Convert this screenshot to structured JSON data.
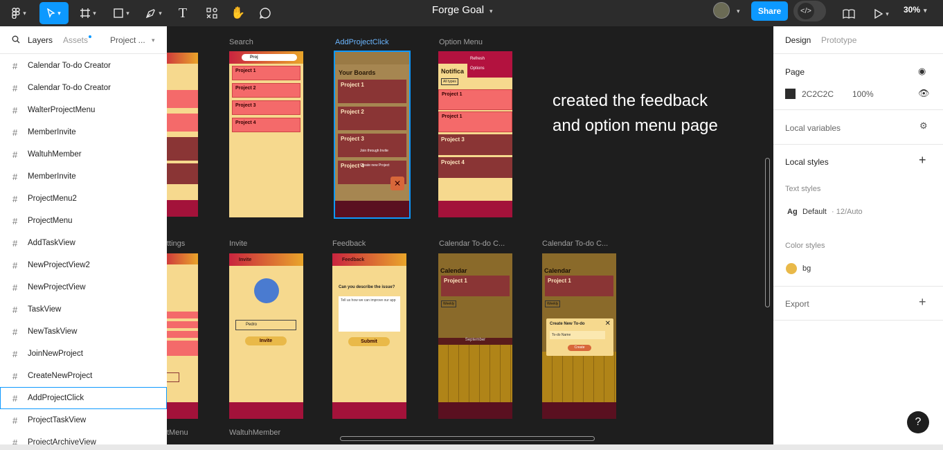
{
  "file": {
    "title": "Forge Goal"
  },
  "toolbar": {
    "share_label": "Share",
    "zoom_label": "30%",
    "icons": [
      "figma-menu-icon",
      "move-tool-icon",
      "frame-tool-icon",
      "shape-tool-icon",
      "pen-tool-icon",
      "text-tool-icon",
      "resources-icon",
      "hand-tool-icon",
      "comment-icon",
      "library-icon",
      "present-icon",
      "dev-mode-icon"
    ]
  },
  "left_panel": {
    "tabs": [
      "Layers",
      "Assets",
      "Project ..."
    ],
    "layers": [
      "Calendar To-do Creator",
      "Calendar To-do Creator",
      "WalterProjectMenu",
      "MemberInvite",
      "WaltuhMember",
      "MemberInvite",
      "ProjectMenu2",
      "ProjectMenu",
      "AddTaskView",
      "NewProjectView2",
      "NewProjectView",
      "TaskView",
      "NewTaskView",
      "JoinNewProject",
      "CreateNewProject",
      "AddProjectClick",
      "ProjectTaskView",
      "ProjectArchiveView"
    ],
    "selected_index": 15
  },
  "right_panel": {
    "tabs": [
      "Design",
      "Prototype"
    ],
    "page_title": "Page",
    "page_color": "2C2C2C",
    "page_color_hex": "#2c2c2c",
    "page_opacity": "100%",
    "local_variables": "Local variables",
    "local_styles": "Local styles",
    "text_styles_label": "Text styles",
    "text_style_name": "Default",
    "text_style_meta": "· 12/Auto",
    "text_style_sample": "Ag",
    "color_styles_label": "Color styles",
    "color_style_name": "bg",
    "color_style_hex": "#e9b949",
    "export_label": "Export"
  },
  "canvas": {
    "note": "created the feedback and option menu page",
    "frame_labels": {
      "search": "Search",
      "add_project_click": "AddProjectClick",
      "option_menu": "Option Menu",
      "settings": "ttings",
      "invite": "Invite",
      "feedback": "Feedback",
      "calendar1": "Calendar To-do C...",
      "calendar2": "Calendar To-do C...",
      "tmenu": "tMenu",
      "waltuh": "WaltuhMember"
    },
    "search_frame": {
      "query": "Proj",
      "items": [
        "Project 1",
        "Project 2",
        "Project 3",
        "Project 4"
      ]
    },
    "add_project": {
      "heading": "Your Boards",
      "items": [
        "Project 1",
        "Project 2",
        "Project 3",
        "Project 4"
      ],
      "join": "Join through Invite",
      "create": "Create new Project"
    },
    "option_menu": {
      "heading": "Notifica",
      "menu": [
        "Refresh",
        "Options"
      ],
      "filter": "All types",
      "items": [
        "Project 1",
        "Project 1",
        "Project 3",
        "Project 4"
      ]
    },
    "invite": {
      "header": "Invite",
      "field": "Pedro",
      "button": "Invite"
    },
    "feedback": {
      "header": "Feedback",
      "question": "Can you describe the issue?",
      "placeholder": "Tell us how we can improve our app",
      "button": "Submit"
    },
    "calendar": {
      "heading": "Calendar",
      "project": "Project 1",
      "month": "September",
      "modal_title": "Create New To-do",
      "modal_field": "To-do Name",
      "modal_button": "Create",
      "filter": "Weekly"
    }
  }
}
